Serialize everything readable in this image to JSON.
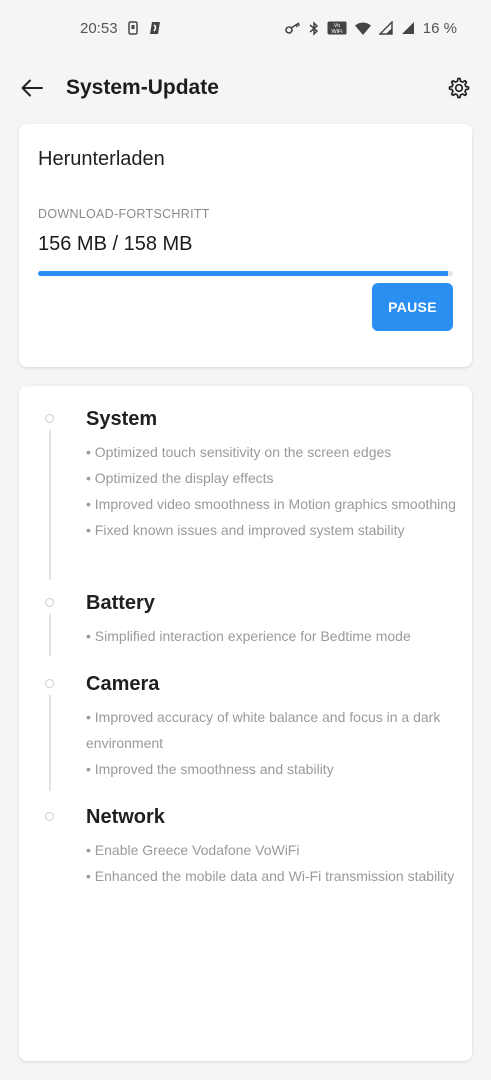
{
  "status_bar": {
    "time": "20:53",
    "battery_percent": "16 %",
    "icons": [
      "sim-icon",
      "app-notification-icon",
      "vpn-key-icon",
      "bluetooth-icon",
      "volte-wifi-icon",
      "wifi-icon",
      "signal-icon",
      "signal-icon-2"
    ]
  },
  "app_bar": {
    "title": "System-Update"
  },
  "download": {
    "heading": "Herunterladen",
    "label": "DOWNLOAD-FORTSCHRITT",
    "progress_text": "156 MB / 158 MB",
    "progress_fraction": 0.987,
    "pause_label": "PAUSE",
    "accent_color": "#2a8ff0"
  },
  "changelog": {
    "sections": [
      {
        "title": "System",
        "items": [
          "• Optimized touch sensitivity on the screen edges",
          "• Optimized the display effects",
          "• Improved video smoothness in Motion graphics smoothing",
          "• Fixed known issues and improved system stability"
        ]
      },
      {
        "title": "Battery",
        "items": [
          "• Simplified interaction experience for Bedtime mode"
        ]
      },
      {
        "title": "Camera",
        "items": [
          "• Improved accuracy of white balance and focus in a dark environment",
          "• Improved the smoothness and stability"
        ]
      },
      {
        "title": "Network",
        "items": [
          "• Enable Greece Vodafone VoWiFi",
          "• Enhanced the mobile data and Wi-Fi transmission stability"
        ]
      }
    ]
  }
}
